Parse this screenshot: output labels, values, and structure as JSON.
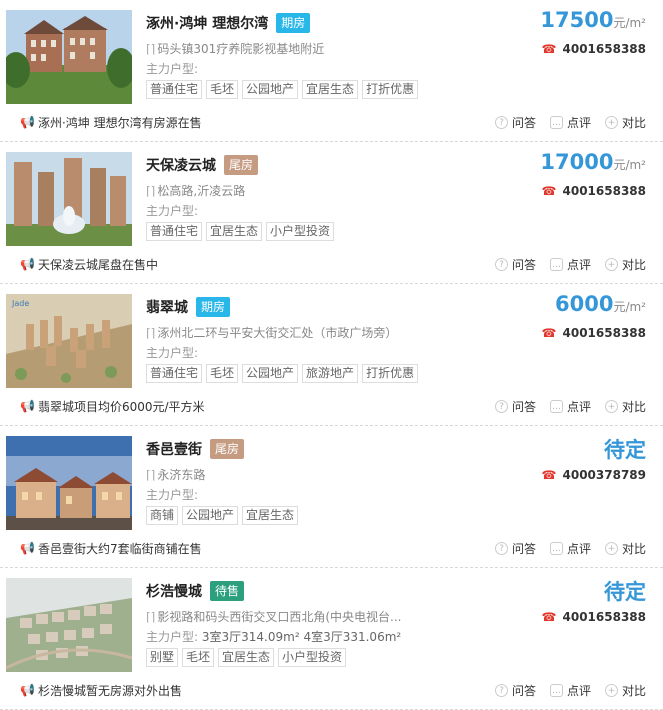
{
  "colors": {
    "price_blue": "#3597d8",
    "tag_blue": "#29b6e8",
    "tag_brown": "#c59b82",
    "tag_green": "#2ca07d",
    "phone_red": "#e0362b"
  },
  "labels": {
    "units_label": "主力户型:",
    "act_ask": "问答",
    "act_review": "点评",
    "act_compare": "对比",
    "price_unit": "元/m²"
  },
  "items": [
    {
      "name": "涿州·鸿坤 理想尔湾",
      "tag": "期房",
      "tag_color": "#29b6e8",
      "address": "码头镇301疗养院影视基地附近",
      "units": "",
      "tags": [
        "普通住宅",
        "毛坯",
        "公园地产",
        "宜居生态",
        "打折优惠"
      ],
      "price": "17500",
      "price_unit": "元/m²",
      "phone": "4001658388",
      "news": "涿州·鸿坤 理想尔湾有房源在售"
    },
    {
      "name": "天保凌云城",
      "tag": "尾房",
      "tag_color": "#c59b82",
      "address": "松高路,沂凌云路",
      "units": "",
      "tags": [
        "普通住宅",
        "宜居生态",
        "小户型投资"
      ],
      "price": "17000",
      "price_unit": "元/m²",
      "phone": "4001658388",
      "news": "天保凌云城尾盘在售中"
    },
    {
      "name": "翡翠城",
      "tag": "期房",
      "tag_color": "#29b6e8",
      "address": "涿州北二环与平安大街交汇处（市政广场旁）",
      "units": "",
      "tags": [
        "普通住宅",
        "毛坯",
        "公园地产",
        "旅游地产",
        "打折优惠"
      ],
      "price": "6000",
      "price_unit": "元/m²",
      "phone": "4001658388",
      "news": "翡翠城项目均价6000元/平方米"
    },
    {
      "name": "香邑壹街",
      "tag": "尾房",
      "tag_color": "#c59b82",
      "address": "永济东路",
      "units": "",
      "tags": [
        "商铺",
        "公园地产",
        "宜居生态"
      ],
      "price": "待定",
      "price_unit": "",
      "phone": "4000378789",
      "news": "香邑壹街大约7套临街商铺在售"
    },
    {
      "name": "杉浩慢城",
      "tag": "待售",
      "tag_color": "#2ca07d",
      "address": "影视路和码头西街交叉口西北角(中央电视台...",
      "units": "3室3厅314.09m²  4室3厅331.06m²",
      "tags": [
        "别墅",
        "毛坯",
        "宜居生态",
        "小户型投资"
      ],
      "price": "待定",
      "price_unit": "",
      "phone": "4001658388",
      "news": "杉浩慢城暂无房源对外出售"
    }
  ]
}
